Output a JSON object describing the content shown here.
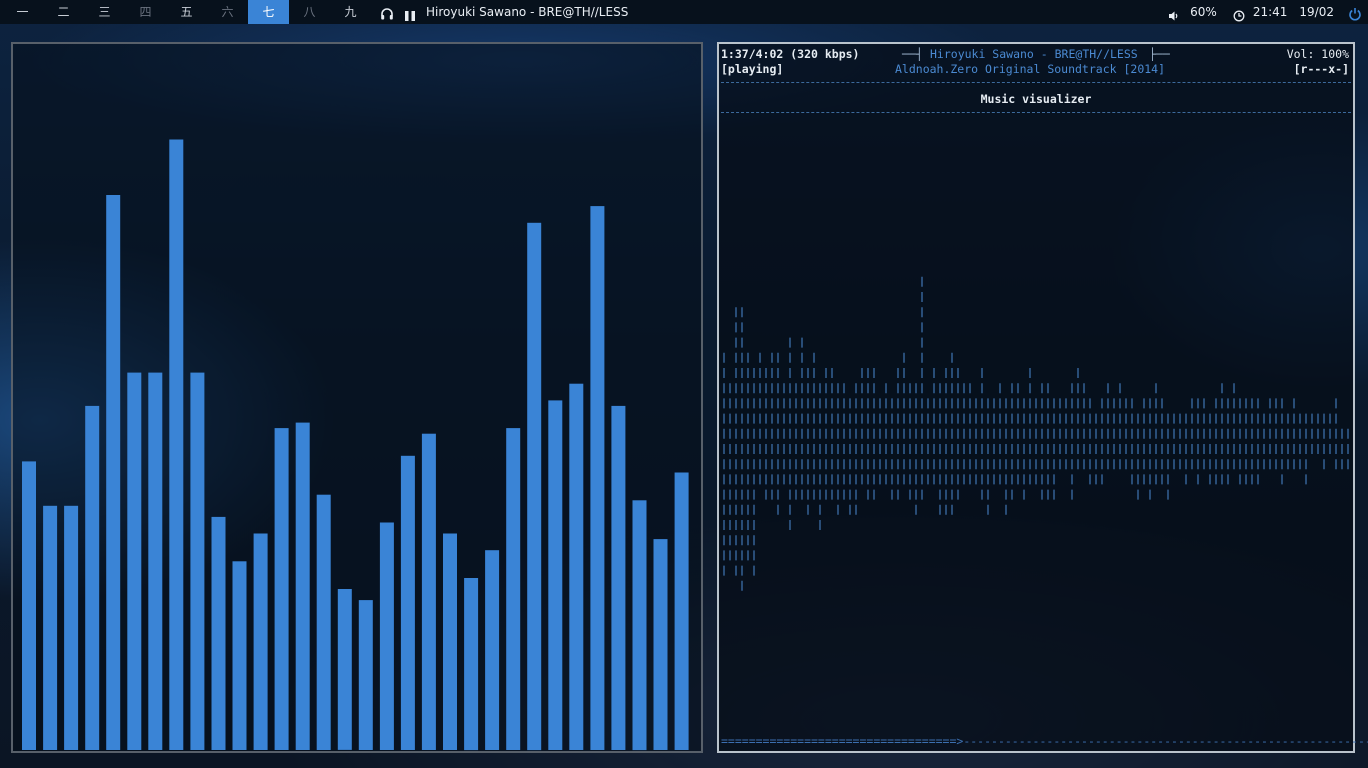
{
  "topbar": {
    "workspaces": [
      {
        "label": "一",
        "state": "normal"
      },
      {
        "label": "二",
        "state": "normal"
      },
      {
        "label": "三",
        "state": "normal"
      },
      {
        "label": "四",
        "state": "dim"
      },
      {
        "label": "五",
        "state": "normal"
      },
      {
        "label": "六",
        "state": "dim"
      },
      {
        "label": "七",
        "state": "active"
      },
      {
        "label": "八",
        "state": "dim"
      },
      {
        "label": "九",
        "state": "normal"
      }
    ],
    "media_icon": "headphones-icon",
    "pause_icon": "pause-icon",
    "now_playing": "Hiroyuki Sawano - BRE@TH//LESS",
    "volume_icon": "speaker-icon",
    "volume": "60%",
    "clock_icon": "clock-icon",
    "time": "21:41",
    "date": "19/02",
    "power_icon": "power-icon",
    "accent": "#3a84d6"
  },
  "visualizer": {
    "bar_color": "#3a84d6",
    "levels": [
      0.52,
      0.44,
      0.44,
      0.62,
      1.0,
      0.68,
      0.68,
      1.1,
      0.68,
      0.42,
      0.34,
      0.39,
      0.58,
      0.59,
      0.46,
      0.29,
      0.27,
      0.41,
      0.53,
      0.57,
      0.39,
      0.31,
      0.36,
      0.58,
      0.95,
      0.63,
      0.66,
      0.98,
      0.62,
      0.45,
      0.38,
      0.5
    ]
  },
  "ncmpcpp": {
    "time": "1:37/4:02 (320 kbps)",
    "title_line": "Hiroyuki Sawano - BRE@TH//LESS",
    "album_line": "Aldnoah.Zero Original Soundtrack [2014]",
    "volume": "Vol: 100%",
    "state": "[playing]",
    "flags": "[r---x-]",
    "screen_title": "Music visualizer",
    "ascii_color": "#4b8ad2",
    "progress": "==================================>--------------------------------------------------------------------"
  }
}
